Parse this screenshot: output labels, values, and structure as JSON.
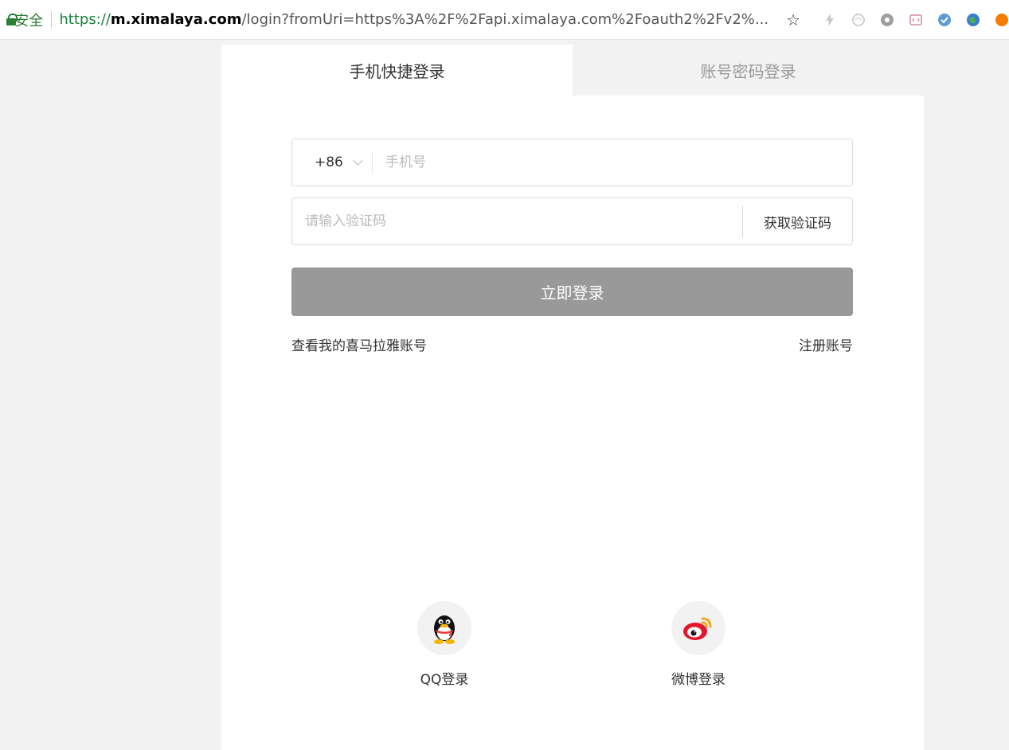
{
  "browser": {
    "secure_label": "安全",
    "url_prefix": "https://",
    "url_domain": "m.ximalaya.com",
    "url_path": "/login?fromUri=https%3A%2F%2Fapi.ximalaya.com%2Foauth2%2Fv2%...",
    "star_glyph": "☆"
  },
  "tabs": [
    {
      "label": "手机快捷登录",
      "active": true
    },
    {
      "label": "账号密码登录",
      "active": false
    }
  ],
  "form": {
    "country_code": "+86",
    "phone_placeholder": "手机号",
    "code_placeholder": "请输入验证码",
    "get_code_label": "获取验证码",
    "login_label": "立即登录",
    "login_button_color": "#999999"
  },
  "links": {
    "view_account": "查看我的喜马拉雅账号",
    "register": "注册账号"
  },
  "social": [
    {
      "label": "QQ登录",
      "icon": "qq-penguin-icon"
    },
    {
      "label": "微博登录",
      "icon": "weibo-icon"
    }
  ]
}
